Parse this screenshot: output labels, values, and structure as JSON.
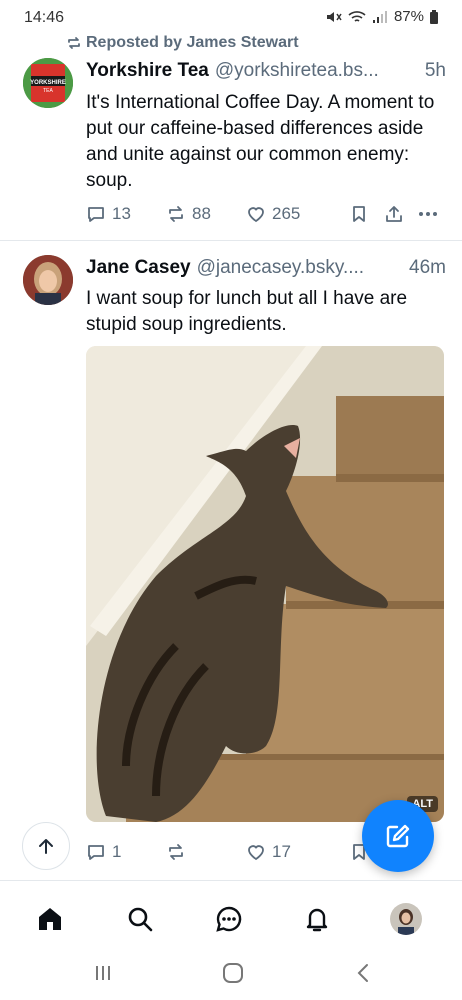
{
  "status_bar": {
    "time": "14:46",
    "battery": "87%"
  },
  "posts": [
    {
      "repost_label": "Reposted by James Stewart",
      "author_name": "Yorkshire Tea",
      "author_handle": "@yorkshiretea.bs...",
      "time": "5h",
      "avatar_text": "YORKSHIRE TEA",
      "text": "It's International Coffee Day. A moment to put our caffeine-based differences aside and unite against our common enemy: soup.",
      "replies": "13",
      "reposts": "88",
      "likes": "265"
    },
    {
      "author_name": "Jane Casey",
      "author_handle": "@janecasey.bsky....",
      "time": "46m",
      "text": "I want soup for lunch but all I have are stupid soup ingredients.",
      "image_alt_badge": "ALT",
      "replies": "1",
      "reposts": "",
      "likes": "17"
    }
  ],
  "tab_bar": {
    "items": [
      "home-icon",
      "search-icon",
      "chat-icon",
      "bell-icon",
      "profile-avatar"
    ]
  },
  "colors": {
    "accent": "#1083fe",
    "muted": "#5b6b7b",
    "text": "#0b0f14"
  }
}
